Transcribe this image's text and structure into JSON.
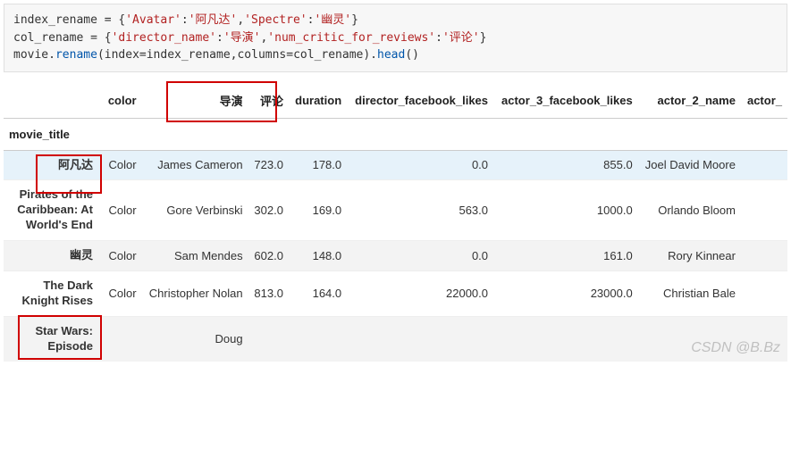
{
  "code": {
    "line1_a": "index_rename = {",
    "line1_b": "'Avatar'",
    "line1_c": ":",
    "line1_d": "'阿凡达'",
    "line1_e": ",",
    "line1_f": "'Spectre'",
    "line1_g": ":",
    "line1_h": "'幽灵'",
    "line1_i": "}",
    "line2_a": "col_rename = {",
    "line2_b": "'director_name'",
    "line2_c": ":",
    "line2_d": "'导演'",
    "line2_e": ",",
    "line2_f": "'num_critic_for_reviews'",
    "line2_g": ":",
    "line2_h": "'评论'",
    "line2_i": "}",
    "line3_a": "movie.",
    "line3_b": "rename",
    "line3_c": "(index=index_rename,columns=col_rename).",
    "line3_d": "head",
    "line3_e": "()"
  },
  "table": {
    "index_name": "movie_title",
    "columns": [
      "color",
      "导演",
      "评论",
      "duration",
      "director_facebook_likes",
      "actor_3_facebook_likes",
      "actor_2_name",
      "actor_"
    ],
    "rows": [
      {
        "idx": "阿凡达",
        "cells": [
          "Color",
          "James Cameron",
          "723.0",
          "178.0",
          "0.0",
          "855.0",
          "Joel David Moore",
          ""
        ]
      },
      {
        "idx": "Pirates of the Caribbean: At World's End",
        "cells": [
          "Color",
          "Gore Verbinski",
          "302.0",
          "169.0",
          "563.0",
          "1000.0",
          "Orlando Bloom",
          ""
        ]
      },
      {
        "idx": "幽灵",
        "cells": [
          "Color",
          "Sam Mendes",
          "602.0",
          "148.0",
          "0.0",
          "161.0",
          "Rory Kinnear",
          ""
        ]
      },
      {
        "idx": "The Dark Knight Rises",
        "cells": [
          "Color",
          "Christopher Nolan",
          "813.0",
          "164.0",
          "22000.0",
          "23000.0",
          "Christian Bale",
          ""
        ]
      },
      {
        "idx": "Star Wars: Episode",
        "cells": [
          "",
          "Doug",
          "",
          "",
          "",
          "",
          "",
          ""
        ]
      }
    ]
  },
  "watermark": "CSDN @B.Bz",
  "chart_data": {
    "type": "table",
    "index_name": "movie_title",
    "columns": [
      "color",
      "导演",
      "评论",
      "duration",
      "director_facebook_likes",
      "actor_3_facebook_likes",
      "actor_2_name"
    ],
    "data": [
      [
        "阿凡达",
        "Color",
        "James Cameron",
        723.0,
        178.0,
        0.0,
        855.0,
        "Joel David Moore"
      ],
      [
        "Pirates of the Caribbean: At World's End",
        "Color",
        "Gore Verbinski",
        302.0,
        169.0,
        563.0,
        1000.0,
        "Orlando Bloom"
      ],
      [
        "幽灵",
        "Color",
        "Sam Mendes",
        602.0,
        148.0,
        0.0,
        161.0,
        "Rory Kinnear"
      ],
      [
        "The Dark Knight Rises",
        "Color",
        "Christopher Nolan",
        813.0,
        164.0,
        22000.0,
        23000.0,
        "Christian Bale"
      ]
    ]
  }
}
